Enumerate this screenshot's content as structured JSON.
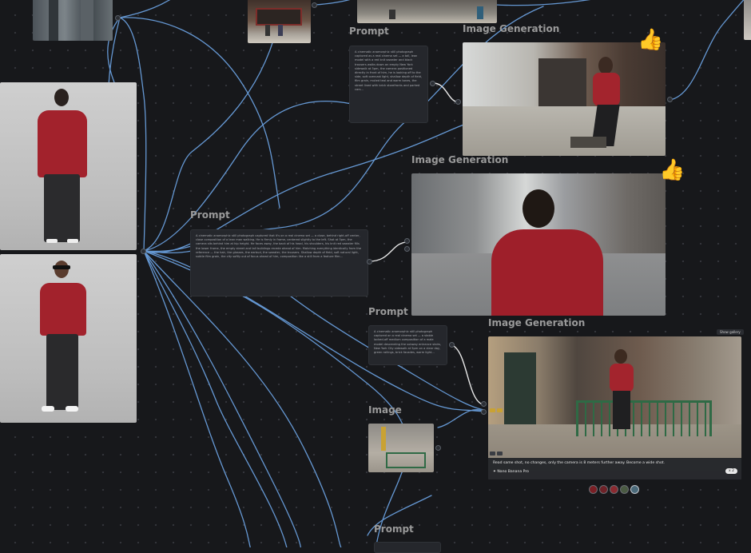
{
  "canvas": {
    "background": "#17181b",
    "wire_color": "#6ea6e8"
  },
  "nodes": {
    "prompt_top": {
      "title": "Prompt",
      "text": "A cinematic anamorphic still photograph captured as a real cinema set — a tall, lean model with a red knit sweater and black trousers walks down an empty New York sidewalk at 5pm, the camera positioned directly in front of him, he is looking off to the side, soft overcast light, shallow depth of field, film grain, muted teal and warm tones, the street lined with brick storefronts and parked cars..."
    },
    "gen_top": {
      "title": "Image Generation",
      "reaction": "👍"
    },
    "prompt_main": {
      "title": "Prompt",
      "text": "A cinematic anamorphic still photograph captured that it's on a real cinema set — a close, behind right-off center, close composition of a lean man walking. He is firmly in frame, centered slightly to the left. Shot at 5pm, the camera sits behind him at hip height. He faces away, the back of his head, his shoulders, his knit red sweater fills the lower frame, the empty street and tall buildings recede ahead of him. Matching everything identically from the reference — the hair, the glasses, the earbud, the sweater, the trousers. Shallow depth of field, soft natural light, subtle film grain, the city softly out of focus ahead of him, composition like a still from a feature film..."
    },
    "gen_middle": {
      "title": "Image Generation",
      "reaction": "👍"
    },
    "prompt_lower": {
      "title": "Prompt",
      "text": "A cinematic anamorphic still photograph captured on a real cinema set — a stable locked-off medium composition of a male model descending the subway entrance stairs, New York City sidewalk at 5pm on a clear day, green railings, brick facades, warm light..."
    },
    "gen_lower": {
      "title": "Image Generation",
      "show_gallery": "Show gallery",
      "prompt_line": "Read same shot, no changes, only the camera is 8 meters further away. Become a wide shot.",
      "model": "Nano Banana Pro",
      "count": "x 2"
    },
    "image_node": {
      "title": "Image"
    },
    "prompt_bottom": {
      "title": "Prompt"
    }
  },
  "icons": {
    "reaction": "thumbs-up-icon",
    "model": "sparkle-icon"
  }
}
